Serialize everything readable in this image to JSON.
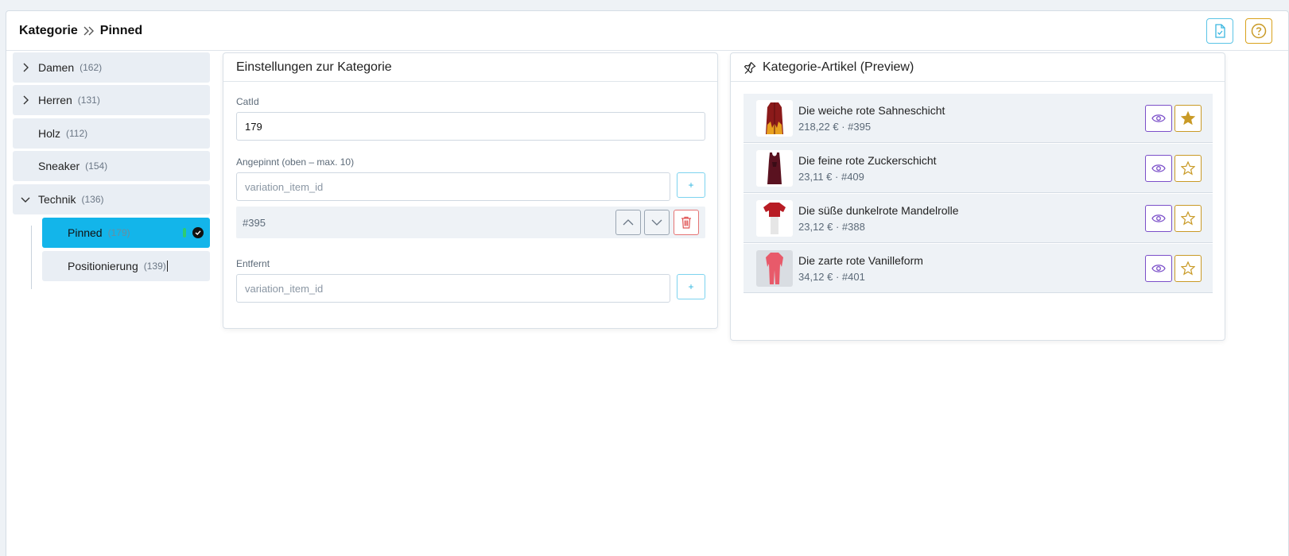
{
  "breadcrumb": {
    "parent": "Kategorie",
    "current": "Pinned"
  },
  "header_icons": {
    "doc": "document-check-icon",
    "help": "question-circle-icon"
  },
  "tree": {
    "nodes": [
      {
        "label": "Damen",
        "count": "(162)",
        "expandable": true,
        "expanded": false
      },
      {
        "label": "Herren",
        "count": "(131)",
        "expandable": true,
        "expanded": false
      },
      {
        "label": "Holz",
        "count": "(112)",
        "expandable": false
      },
      {
        "label": "Sneaker",
        "count": "(154)",
        "expandable": false
      },
      {
        "label": "Technik",
        "count": "(136)",
        "expandable": true,
        "expanded": true
      }
    ],
    "children": [
      {
        "label": "Pinned",
        "count": "(179)",
        "active": true
      },
      {
        "label": "Positionierung",
        "count": "(139)",
        "active": false
      }
    ]
  },
  "settings": {
    "title": "Einstellungen zur Kategorie",
    "catid_label": "CatId",
    "catid_value": "179",
    "pinned_label": "Angepinnt (oben – max. 10)",
    "pinned_placeholder": "variation_item_id",
    "add_label": "+",
    "pinned_items": [
      "#395"
    ],
    "removed_label": "Entfernt",
    "removed_placeholder": "variation_item_id"
  },
  "preview": {
    "title": "Kategorie-Artikel (Preview)",
    "title_icon": "pin-icon",
    "items": [
      {
        "name": "Die weiche rote Sahneschicht",
        "meta": "218,22 € · #395",
        "starred": true
      },
      {
        "name": "Die feine rote Zuckerschicht",
        "meta": "23,11 € · #409",
        "starred": false
      },
      {
        "name": "Die süße dunkelrote Mandelrolle",
        "meta": "23,12 € · #388",
        "starred": false
      },
      {
        "name": "Die zarte rote Vanilleform",
        "meta": "34,12 € · #401",
        "starred": false
      }
    ]
  },
  "colors": {
    "accent": "#13b5ea",
    "purple": "#7b4fc9",
    "gold": "#c99a26",
    "danger": "#e57373"
  }
}
